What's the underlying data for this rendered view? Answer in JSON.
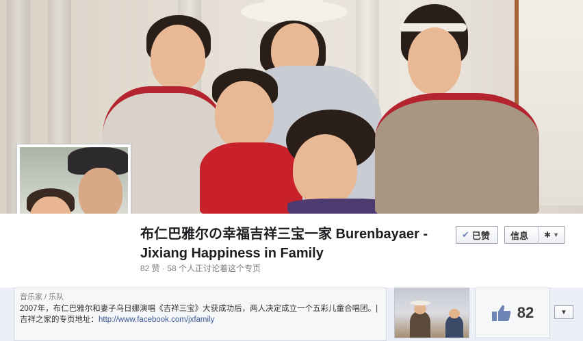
{
  "page": {
    "title": "布仁巴雅尔の幸福吉祥三宝一家 Burenbayaer - Jixiang Happiness in Family",
    "stats": "82 赞 · 58 个人正讨论着这个专页"
  },
  "actions": {
    "liked_label": "已赞",
    "info_label": "信息"
  },
  "about": {
    "category": "音乐家 / 乐队",
    "description": "2007年，布仁巴雅尔和妻子乌日娜演唱《吉祥三宝》大获成功后，两人决定成立一个五彩儿童合唱团。| 吉祥之家的专页地址：",
    "link": "http://www.facebook.com/jxfamily"
  },
  "likes": {
    "count": "82"
  },
  "icons": {
    "liked": "check-icon",
    "settings": "gear-icon",
    "dropdown": "caret-down-icon",
    "thumb": "thumbs-up-icon"
  },
  "colors": {
    "link": "#3b5998",
    "border": "#999fab"
  }
}
